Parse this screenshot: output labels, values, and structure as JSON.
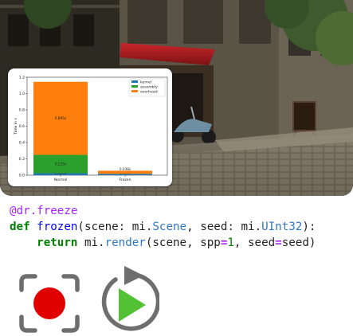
{
  "colors": {
    "kernel": "#1f77b4",
    "assembly": "#2ca02c",
    "overhead": "#ff7f0e",
    "record_button": "#e00000",
    "replay_triangle": "#52c234",
    "icon_gray": "#6e6e6e"
  },
  "icons": {
    "record": "record-button-icon",
    "replay": "replay-play-icon"
  },
  "chart_data": {
    "type": "bar",
    "stacked": true,
    "categories": [
      "Normal",
      "Frozen"
    ],
    "ylabel": "Time in s",
    "ylim": [
      0,
      1.2
    ],
    "yticks": [
      "0.0",
      "0.2",
      "0.4",
      "0.6",
      "0.8",
      "1.0",
      "1.2"
    ],
    "legend_position": "top-right",
    "series": [
      {
        "name": "kernel",
        "values": [
          0.024,
          0.016
        ],
        "labels": [
          "0.024s",
          "0.016s"
        ]
      },
      {
        "name": "assembly",
        "values": [
          0.225,
          0.0
        ],
        "labels": [
          "0.225s",
          ""
        ]
      },
      {
        "name": "overhead",
        "values": [
          0.895,
          0.038
        ],
        "labels": [
          "0.895s",
          "0.038s"
        ]
      }
    ]
  },
  "code": {
    "line1": {
      "decorator": "@dr.freeze"
    },
    "line2": {
      "def": "def",
      "fname": "frozen",
      "p1": "(scene: mi.",
      "t1": "Scene",
      "p2": ", seed: mi.",
      "t2": "UInt32",
      "p3": "):"
    },
    "line3": {
      "indent": "    ",
      "ret": "return",
      "p1": " mi.",
      "fn": "render",
      "p2": "(scene, spp",
      "eq1": "=",
      "num": "1",
      "p3": ", seed",
      "eq2": "=",
      "p4": "seed)"
    }
  }
}
